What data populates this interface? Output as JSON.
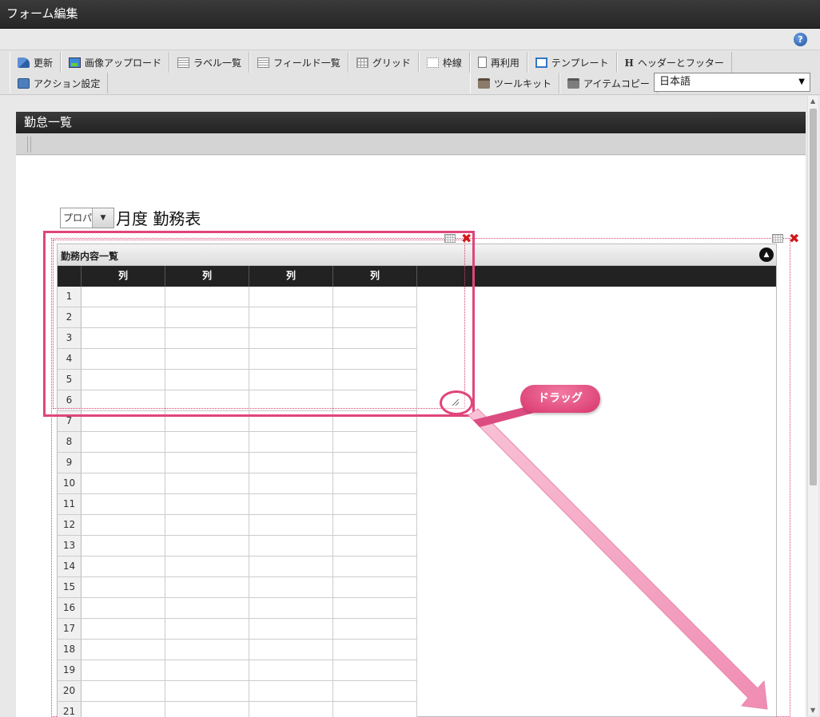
{
  "window": {
    "title": "フォーム編集"
  },
  "help": {
    "icon": "help-icon",
    "glyph": "?"
  },
  "toolbar": {
    "row1": [
      {
        "name": "update-button",
        "icon": "refresh-icon",
        "label": "更新"
      },
      {
        "name": "image-upload-button",
        "icon": "image-icon",
        "label": "画像アップロード"
      },
      {
        "name": "label-list-button",
        "icon": "list-icon",
        "label": "ラベル一覧"
      },
      {
        "name": "field-list-button",
        "icon": "list-icon",
        "label": "フィールド一覧"
      },
      {
        "name": "grid-button",
        "icon": "grid-icon",
        "label": "グリッド"
      },
      {
        "name": "frame-line-button",
        "icon": "frame-icon",
        "label": "枠線"
      },
      {
        "name": "reuse-button",
        "icon": "page-icon",
        "label": "再利用"
      },
      {
        "name": "template-button",
        "icon": "template-icon",
        "label": "テンプレート"
      },
      {
        "name": "header-footer-button",
        "icon": "h-icon",
        "label": "ヘッダーとフッター"
      }
    ],
    "row2_left": [
      {
        "name": "action-settings-button",
        "icon": "action-icon",
        "label": "アクション設定"
      }
    ],
    "row2_right": [
      {
        "name": "toolkit-button",
        "icon": "toolkit-icon",
        "label": "ツールキット"
      },
      {
        "name": "item-copy-button",
        "icon": "copy-icon",
        "label": "アイテムコピー"
      }
    ],
    "language": {
      "value": "日本語",
      "arrow": "▼"
    }
  },
  "form": {
    "header_title": "勤怠一覧",
    "month_select": {
      "value": "プロパ",
      "arrow": "▼"
    },
    "page_heading": "月度 勤務表",
    "grid": {
      "title": "勤務内容一覧",
      "columns": [
        "列",
        "列",
        "列",
        "列"
      ],
      "rows": [
        "1",
        "2",
        "3",
        "4",
        "5",
        "6",
        "7",
        "8",
        "9",
        "10",
        "11",
        "12",
        "13",
        "14",
        "15",
        "16",
        "17",
        "18",
        "19",
        "20",
        "21"
      ]
    }
  },
  "annotation": {
    "drag_label": "ドラッグ",
    "accent_color": "#e0457b"
  },
  "icons": {
    "close": "✖",
    "collapse": "▲",
    "scroll_up": "▲",
    "scroll_down": "▼"
  }
}
